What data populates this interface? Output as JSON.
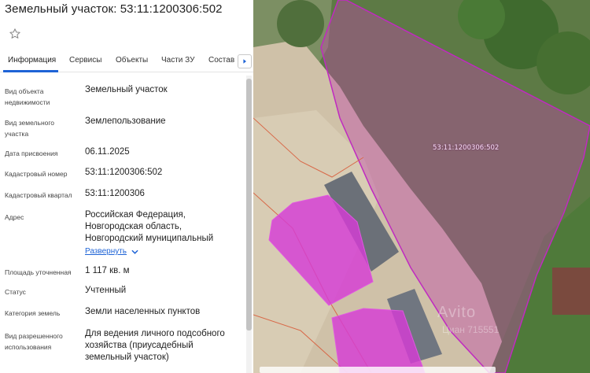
{
  "header": {
    "title": "Земельный участок: 53:11:1200306:502"
  },
  "tabs": [
    {
      "label": "Информация"
    },
    {
      "label": "Сервисы"
    },
    {
      "label": "Объекты"
    },
    {
      "label": "Части ЗУ"
    },
    {
      "label": "Состав"
    }
  ],
  "fields": {
    "object_type": {
      "label_1": "Вид объекта",
      "label_2": "недвижимости",
      "value": "Земельный участок"
    },
    "land_type": {
      "label_1": "Вид земельного",
      "label_2": "участка",
      "value": "Землепользование"
    },
    "date": {
      "label": "Дата присвоения",
      "value": "06.11.2025"
    },
    "cad_number": {
      "label": "Кадастровый номер",
      "value": "53:11:1200306:502"
    },
    "cad_quarter": {
      "label": "Кадастровый квартал",
      "value": "53:11:1200306"
    },
    "address": {
      "label": "Адрес",
      "line_1": "Российская Федерация,",
      "line_2": "Новгородская область,",
      "line_3": "Новгородский муниципальный",
      "expand": "Развернуть"
    },
    "area": {
      "label": "Площадь уточненная",
      "value": "1 117 кв. м"
    },
    "status": {
      "label": "Статус",
      "value": "Учтенный"
    },
    "category": {
      "label": "Категория земель",
      "value": "Земли населенных пунктов"
    },
    "permitted_use": {
      "label_1": "Вид разрешенного",
      "label_2": "использования",
      "line_1": "Для ведения личного подсобного",
      "line_2": "хозяйства (приусадебный",
      "line_3": "земельный участок)"
    }
  },
  "map": {
    "parcel_label": "53:11:1200306:502",
    "watermark": "Avito",
    "watermark_sub": "Циан 715551"
  },
  "colors": {
    "accent": "#1e63d6",
    "parcel_border": "#c02ac0",
    "parcel_fill": "#c84fc4",
    "building_fill": "#d63cd6"
  },
  "icons": {
    "favorite": "star-outline-icon",
    "tabs_next": "chevron-right-icon",
    "expand": "chevron-down-icon"
  }
}
